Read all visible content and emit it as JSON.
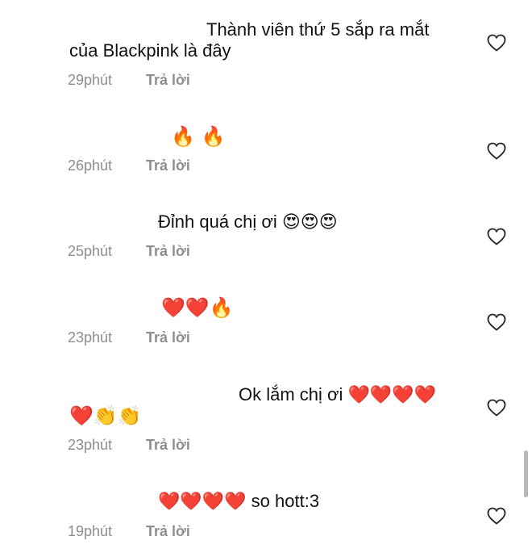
{
  "comments": [
    {
      "text_line1": "Thành viên thứ 5 sắp ra mắt",
      "text_line2": "của Blackpink là đây",
      "time": "29phút",
      "reply": "Trả lời",
      "like_icon": "heart-outline-icon"
    },
    {
      "text": "🔥 🔥",
      "time": "26phút",
      "reply": "Trả lời",
      "like_icon": "heart-outline-icon"
    },
    {
      "text": "Đỉnh quá chị ơi 😍😍😍",
      "time": "25phút",
      "reply": "Trả lời",
      "like_icon": "heart-outline-icon"
    },
    {
      "text": "❤️❤️🔥",
      "time": "23phút",
      "reply": "Trả lời",
      "like_icon": "heart-outline-icon"
    },
    {
      "text_line1": "Ok lắm chị ơi ❤️❤️❤️❤️",
      "text_line2": "❤️👏👏",
      "time": "23phút",
      "reply": "Trả lời",
      "like_icon": "heart-outline-icon"
    },
    {
      "text": "❤️❤️❤️❤️ so hott:3",
      "time": "19phút",
      "reply": "Trả lời",
      "like_icon": "heart-outline-icon"
    }
  ],
  "colors": {
    "text": "#111111",
    "meta": "#8e8e8e",
    "background": "#ffffff"
  }
}
